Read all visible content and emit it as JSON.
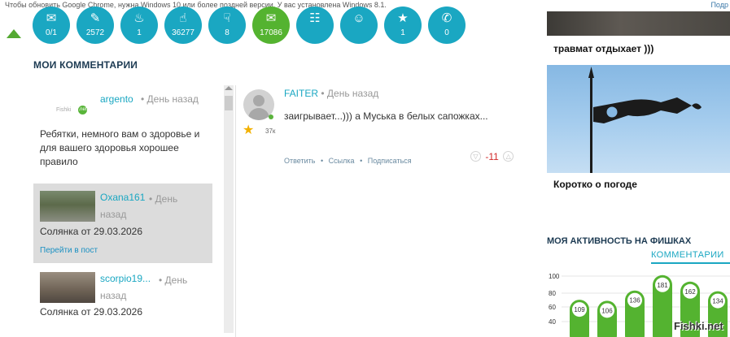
{
  "topbar": {
    "message": "Чтобы обновить Google Chrome, нужна Windows 10 или более поздней версии. У вас установлена Windows 8.1.",
    "right_link": "Подр"
  },
  "stats": [
    {
      "icon": "envelope-icon",
      "glyph": "✉",
      "value": "0/1",
      "color": "#1aa7c2"
    },
    {
      "icon": "pen-icon",
      "glyph": "✎",
      "value": "2572",
      "color": "#1aa7c2"
    },
    {
      "icon": "fire-icon",
      "glyph": "♨",
      "value": "1",
      "color": "#1aa7c2"
    },
    {
      "icon": "thumb-up-icon",
      "glyph": "☝",
      "value": "36277",
      "color": "#1aa7c2"
    },
    {
      "icon": "thumb-down-icon",
      "glyph": "☟",
      "value": "8",
      "color": "#1aa7c2"
    },
    {
      "icon": "comment-icon",
      "glyph": "✉",
      "value": "17086",
      "color": "#54b330"
    },
    {
      "icon": "comments-icon",
      "glyph": "☷",
      "value": "",
      "color": "#1aa7c2"
    },
    {
      "icon": "users-icon",
      "glyph": "☺",
      "value": "",
      "color": "#1aa7c2"
    },
    {
      "icon": "star-icon",
      "glyph": "★",
      "value": "1",
      "color": "#1aa7c2"
    },
    {
      "icon": "chat-icon",
      "glyph": "✆",
      "value": "0",
      "color": "#1aa7c2"
    }
  ],
  "section_title": "МОИ КОММЕНТАРИИ",
  "comments": [
    {
      "author": "argento",
      "meta": "• День назад",
      "text": "Ребятки, немного вам о здоровье и для вашего здоровья хорошее правило",
      "logo_text": "Fishki",
      "logo_badge": ".net"
    },
    {
      "author": "Oxana161",
      "meta": "• День назад",
      "post": "Солянка от 29.03.2026",
      "link": "Перейти в пост"
    },
    {
      "author": "scorpio19...",
      "meta": "• День назад",
      "post": "Солянка от 29.03.2026"
    }
  ],
  "reply": {
    "author": "FAITER",
    "meta": "• День назад",
    "rating": "37к",
    "text": "заигрывает...))) а Муська в белых сапожках...",
    "actions": [
      "Ответить",
      "•",
      "Ссылка",
      "•",
      "Подписаться"
    ],
    "vote": "-11"
  },
  "news": [
    {
      "title": "травмат отдыхает )))"
    },
    {
      "title": "Коротко о погоде"
    }
  ],
  "activity": {
    "title": "МОЯ АКТИВНОСТЬ НА ФИШКАХ",
    "tab": "КОММЕНТАРИИ"
  },
  "chart_data": {
    "type": "bar",
    "values": [
      109,
      106,
      136,
      181,
      162,
      134
    ],
    "yticks": [
      "100",
      "80",
      "60",
      "40"
    ],
    "ylim": [
      0,
      100
    ],
    "colors": {
      "bar": "#54b330",
      "label_bg": "#ffffff"
    }
  },
  "watermark": "Fishki.net"
}
